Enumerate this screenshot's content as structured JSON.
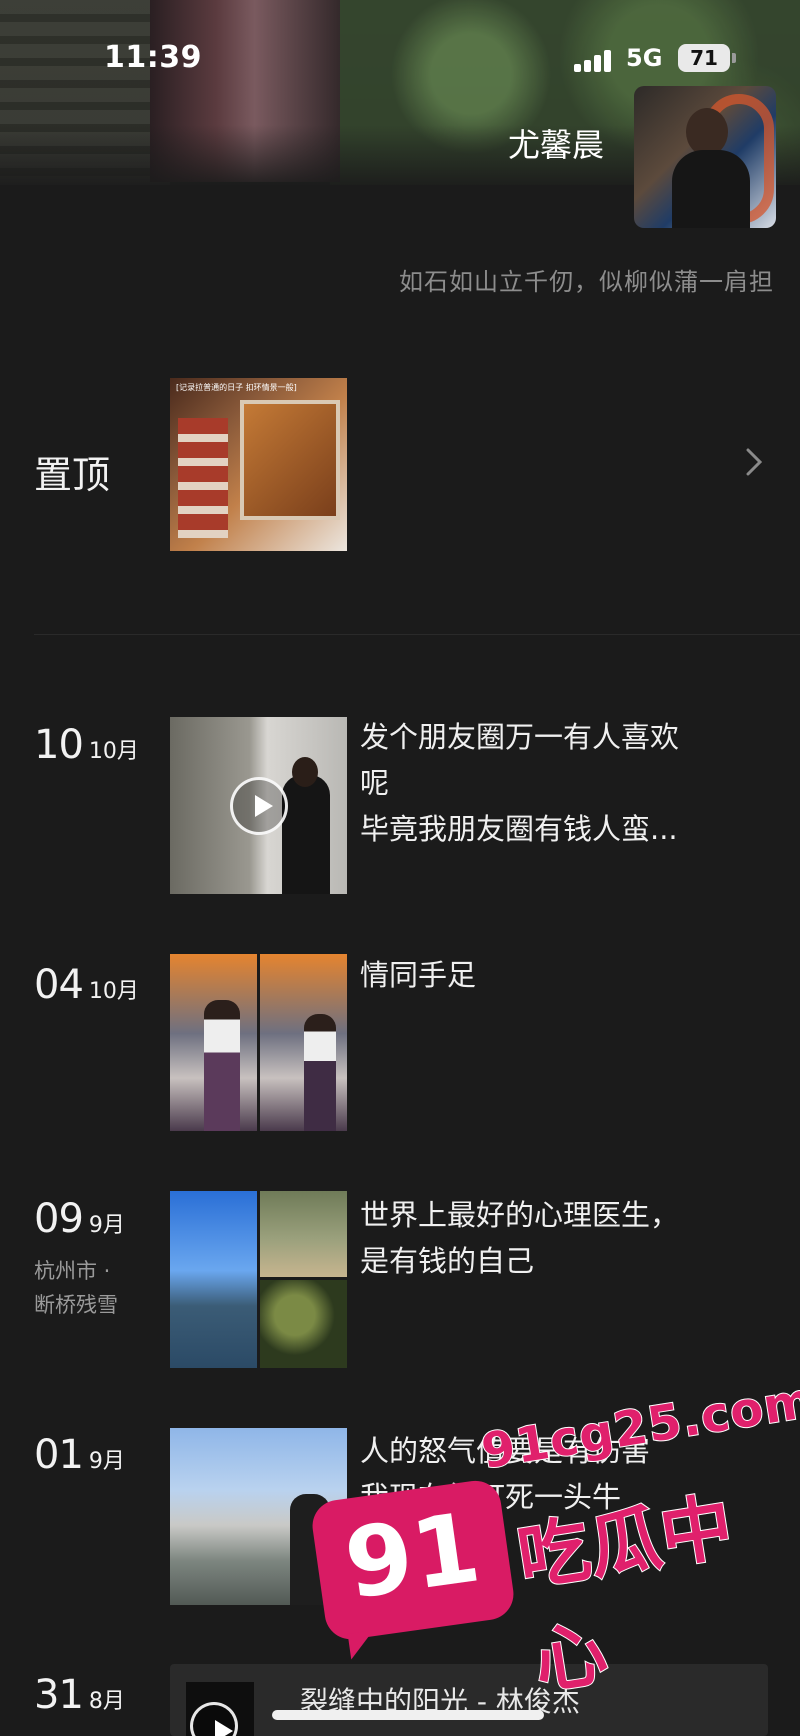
{
  "status_bar": {
    "time": "11:39",
    "network": "5G",
    "battery": "71"
  },
  "profile": {
    "name": "尤馨晨",
    "signature": "如石如山立千仞，似柳似蒲一肩担"
  },
  "pinned": {
    "label": "置顶",
    "thumb_caption": "[记录拉普通的日子 扣环情景一般]"
  },
  "posts": [
    {
      "day": "10",
      "month": "10月",
      "text_line1": "发个朋友圈万一有人喜欢",
      "text_line2": "呢",
      "text_line3": "毕竟我朋友圈有钱人蛮..."
    },
    {
      "day": "04",
      "month": "10月",
      "text_line1": "情同手足"
    },
    {
      "day": "09",
      "month": "9月",
      "location_line1": "杭州市 ·",
      "location_line2": "断桥残雪",
      "text_line1": "世界上最好的心理医生，",
      "text_line2": "是有钱的自己"
    },
    {
      "day": "01",
      "month": "9月",
      "text_line1": "人的怒气值要是有伤害",
      "text_line2": "我现在能打死一头牛"
    },
    {
      "day": "31",
      "month": "8月",
      "music_title": "裂缝中的阳光 - 林俊杰"
    }
  ],
  "watermark": {
    "url": "91cg25.com",
    "logo": "91",
    "text": "吃瓜中心"
  },
  "colors": {
    "background": "#1b1b1b",
    "text": "#f0f0f0",
    "muted": "#8d8d8d",
    "watermark": "#e0206c"
  }
}
